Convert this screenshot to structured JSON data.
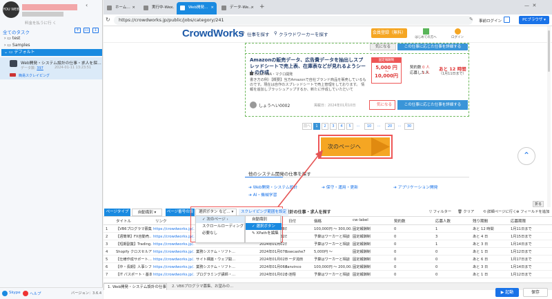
{
  "left_panel": {
    "logo_text": "YOU\nWEB",
    "credit": "料金を払うに行 く",
    "all_tasks": "全てのタスク",
    "tree": [
      {
        "label": "test"
      },
      {
        "label": "Samples"
      },
      {
        "label": "デフォルト"
      }
    ],
    "task": {
      "title": "Web開発・システム設計の仕事・求人を探…",
      "count_label": "データ数",
      "count": "397",
      "date": "2024-01-11 13:23:51",
      "label": "簡易スクレイピング"
    },
    "footer": {
      "skype": "Skype",
      "help": "ヘルプ",
      "version": "バージョン：3.6.4"
    }
  },
  "browser": {
    "tabs": [
      {
        "label": "ホーム…",
        "active": false
      },
      {
        "label": "実行中-We…",
        "active": false
      },
      {
        "label": "Web開発…",
        "active": true
      },
      {
        "label": "データ-We…",
        "active": false
      }
    ],
    "url": "https://crowdworks.jp/public/jobs/category/241",
    "login": "事前ログイン",
    "pc_mode": "PCブラウザ"
  },
  "site": {
    "logo": "CrowdWorks",
    "find_job": "仕事を探す",
    "find_worker": "クラウドワーカーを探す",
    "register": "会員登録（無料）",
    "beginner": "はじめての方へ",
    "login": "ログイン",
    "job": {
      "title": "Amazonの販売データ、広告費データを抽出しスプレッドシートで売上表、在庫表などが見れるようシートの作成",
      "category": "Excel VBA・マクロ開発",
      "category2": "",
      "description": "書き方の例）【概要】当方Amazonで自社ブランド商品を販売しているものです。現在は自作のスプレッドシートで売上管理をしております。 情報を追加しブラッシュアップするか、新たに作成していただいて",
      "price_header": "固定報酬制",
      "price_from": "5,000 円",
      "price_to": "10,000円",
      "stat_label1": "契約数",
      "stat_val1": "0 人",
      "stat_label2": "応募した人",
      "stat_val2": "1 人",
      "days_left": "あと 12 時間",
      "days_sub": "（1月11日まで）",
      "user": "しょうへい0002",
      "posted": "掲載日：2024年01月10日",
      "fav": "気になる",
      "see": "この仕事に応じた仕事を詳細する"
    },
    "top_buttons": [
      "気になる",
      "この仕事に応じた仕事を詳細する"
    ],
    "pagination": [
      "前へ",
      "1",
      "2",
      "3",
      "4",
      "5",
      "…",
      "10",
      "…",
      "20",
      "…",
      "30"
    ],
    "next_page": "次のページへ",
    "other_title": "他のシステム開発の仕事を探す",
    "other_links": [
      "Web開発・システム設計",
      "保守・運用・更新",
      "アプリケーション開発",
      "AI・機械学習"
    ]
  },
  "panel": {
    "toolbar": {
      "page_type_label": "ページタイプ",
      "page_type_value": "自動識別",
      "page_num_label": "ページ番号の設定",
      "page_num_value": "選択ボタン など…",
      "scroll_hint": "スクレイピング範囲を設定",
      "filter": "フィルター",
      "clear": "クリア",
      "page_list": "詳細ページに行く",
      "add_field": "フィールドを追加",
      "collapse": "折る",
      "panel_title": "Web開発・システム設計の仕事・求人を探す"
    },
    "menu_left": [
      {
        "label": "次のページ",
        "checked": true
      },
      {
        "label": "スクロールローディング",
        "checked": false
      },
      {
        "label": "必要なし",
        "checked": false
      }
    ],
    "menu_right": [
      {
        "label": "自動識別",
        "checked": false
      },
      {
        "label": "選択ボタン",
        "checked": true
      },
      {
        "label": "XPathを編集",
        "checked": false
      }
    ],
    "columns": [
      "タイトル",
      "リンク",
      "",
      "日付",
      "価格",
      "cw-label",
      "契約数",
      "応募人数",
      "残り期間",
      "応募期限"
    ],
    "rows": [
      [
        "【VB6プログラマ募集…",
        "https://crowdworks.jp/…",
        "",
        "2024年01月28日",
        "100,000円 ～ 300,00…",
        "固定報酬制",
        "0",
        "1",
        "あと 12 時間",
        "1月11日まで"
      ],
      [
        "【週簡単】FX自動売…",
        "https://crowdworks.jp/…",
        "",
        "2024年01月02日",
        "予算はワーカーと相談",
        "固定報酬制",
        "0",
        "3",
        "あと 4 日",
        "1月15日まで"
      ],
      [
        "【短期副業】Trading…",
        "https://crowdworks.jp/…",
        "",
        "2024年01月02日",
        "予算はワーカーと相談",
        "固定報酬制",
        "0",
        "1",
        "あと 3 日",
        "1月14日まで"
      ],
      [
        "Shopify クロスセルア…",
        "https://crowdworks.jp/…",
        "業務システム・ソフト…",
        "2024年01月07日",
        "5,000円 ～",
        "固定報酬制",
        "0",
        "0",
        "あと 1 日",
        "1月12日まで"
      ],
      [
        "【仕様作成サポート…",
        "https://crowdworks.jp/…",
        "サイト構築・ウェブ開…",
        "2024年01月02日",
        "予算はワーカーと相談",
        "固定報酬制",
        "0",
        "0",
        "あと 6 日",
        "1月17日まで"
      ],
      [
        "【中・長期】人事シフ…",
        "https://crowdworks.jp/…",
        "業務システム・ソフト…",
        "2024年01月06日",
        "100,000円 ～ 200,00…",
        "固定報酬制",
        "0",
        "0",
        "あと 3 日",
        "1月14日まで"
      ],
      [
        "【IT パスポート・基本…",
        "https://crowdworks.jp/…",
        "プログラミング講師・…",
        "2024年01月02日",
        "予算はワーカーと相談",
        "固定報酬制",
        "0",
        "0",
        "あと 1 日",
        "1月12日まで"
      ]
    ],
    "row_extra": [
      "rosecashe7",
      "danvinco",
      "リーダ浅田",
      "小池翔"
    ],
    "bottom_tabs": [
      "1. Web開発・システム設計の仕事",
      "2. VB6プログラマ募集、お望みの…"
    ],
    "start": "起動",
    "save": "保存"
  },
  "colors": {
    "accent": "#1a8ae0",
    "orange": "#f5a623",
    "red_frame": "#e55555"
  }
}
